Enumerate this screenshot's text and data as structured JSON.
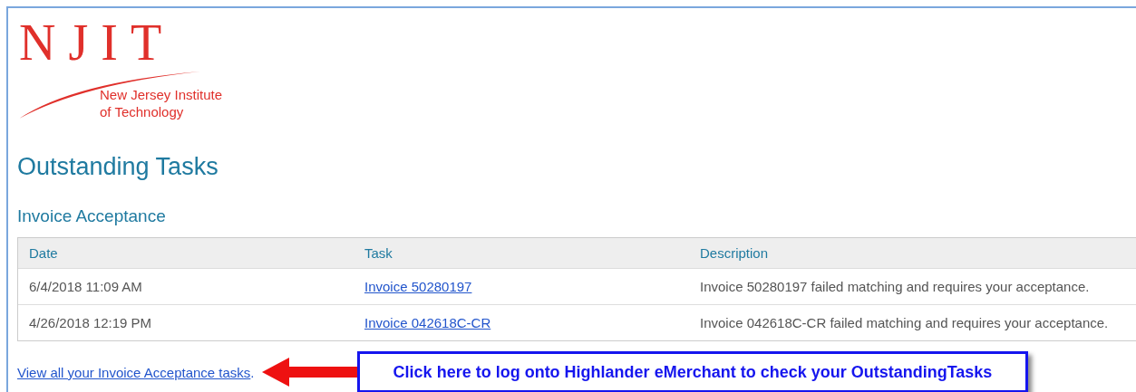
{
  "logo": {
    "mark": "NJIT",
    "lines": [
      "New Jersey Institute",
      "of Technology"
    ]
  },
  "title": "Outstanding Tasks",
  "section": "Invoice Acceptance",
  "table": {
    "columns": [
      "Date",
      "Task",
      "Description"
    ],
    "rows": [
      {
        "date": "6/4/2018 11:09 AM",
        "task": "Invoice 50280197",
        "description": "Invoice 50280197 failed matching and requires your acceptance."
      },
      {
        "date": "4/26/2018 12:19 PM",
        "task": "Invoice 042618C-CR",
        "description": "Invoice 042618C-CR failed matching and requires your acceptance."
      }
    ]
  },
  "footer_link": {
    "text": "View all your Invoice Acceptance tasks",
    "after": "."
  },
  "callout": "Click here to log onto Highlander eMerchant to check your OutstandingTasks"
}
